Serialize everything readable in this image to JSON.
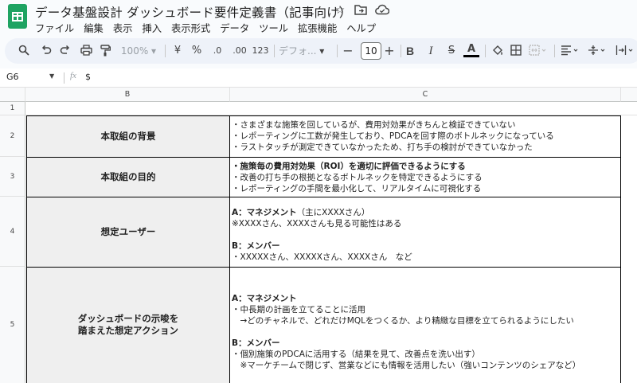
{
  "title": "データ基盤設計 ダッシュボード要件定義書（記事向け）",
  "menu": [
    "ファイル",
    "編集",
    "表示",
    "挿入",
    "表示形式",
    "データ",
    "ツール",
    "拡張機能",
    "ヘルプ"
  ],
  "toolbar": {
    "zoom": "100%",
    "currency": "¥",
    "percent": "%",
    "dec_decrease": ".0",
    "dec_increase": ".00",
    "number_format": "123",
    "font": "デフォ...",
    "minus": "−",
    "font_size": "10",
    "plus": "+",
    "bold": "B",
    "italic": "I",
    "strike": "S",
    "text_color": "A"
  },
  "formula_bar": {
    "cell_ref": "G6",
    "fx": "fx",
    "value": "$"
  },
  "columns": [
    "B",
    "C"
  ],
  "rows": [
    {
      "num": "1",
      "label": "",
      "content": []
    },
    {
      "num": "2",
      "label": "本取組の背景",
      "content": [
        {
          "text": "・さまざまな施策を回しているが、費用対効果がきちんと検証できていない",
          "bold": false
        },
        {
          "text": "・レポーティングに工数が発生しており、PDCAを回す際のボトルネックになっている",
          "bold": false
        },
        {
          "text": "・ラストタッチが測定できていなかったため、打ち手の検討ができていなかった",
          "bold": false
        }
      ]
    },
    {
      "num": "3",
      "label": "本取組の目的",
      "content": [
        {
          "text": "・施策毎の費用対効果（ROI）を適切に評価できるようにする",
          "bold": true
        },
        {
          "text": "・改善の打ち手の根拠となるボトルネックを特定できるようにする",
          "bold": false
        },
        {
          "text": "・レポーティングの手間を最小化して、リアルタイムに可視化する",
          "bold": false
        }
      ]
    },
    {
      "num": "4",
      "label": "想定ユーザー",
      "content": [
        {
          "text": "A：マネジメント（主にXXXXさん）",
          "bold": "partial",
          "bold_part": "A：マネジメント",
          "rest": "（主にXXXXさん）"
        },
        {
          "text": "※XXXXさん、XXXXさんも見る可能性はある",
          "bold": false
        },
        {
          "text": "",
          "bold": false
        },
        {
          "text": "B：メンバー",
          "bold": true
        },
        {
          "text": "・XXXXXさん、XXXXXさん、XXXXさん　など",
          "bold": false
        }
      ]
    },
    {
      "num": "5",
      "label": "ダッシュボードの示唆を\n踏まえた想定アクション",
      "content": [
        {
          "text": "A：マネジメント",
          "bold": true
        },
        {
          "text": "・中長期の計画を立てることに活用",
          "bold": false
        },
        {
          "text": "　→どのチャネルで、どれだけMQLをつくるか、より精緻な目標を立てられるようにしたい",
          "bold": false
        },
        {
          "text": "",
          "bold": false
        },
        {
          "text": "B：メンバー",
          "bold": true
        },
        {
          "text": "・個別施策のPDCAに活用する（結果を見て、改善点を洗い出す）",
          "bold": false
        },
        {
          "text": "　※マーケチームで閉じず、営業などにも情報を活用したい（強いコンテンツのシェアなど）",
          "bold": false
        }
      ]
    }
  ]
}
